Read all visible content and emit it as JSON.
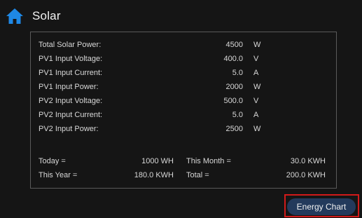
{
  "header": {
    "title": "Solar",
    "home_icon": "home-icon",
    "home_icon_color": "#1e88e5"
  },
  "readings": [
    {
      "label": "Total Solar Power:",
      "value": "4500",
      "unit": "W"
    },
    {
      "label": "PV1 Input Voltage:",
      "value": "400.0",
      "unit": "V"
    },
    {
      "label": "PV1 Input Current:",
      "value": "5.0",
      "unit": "A"
    },
    {
      "label": "PV1 Input Power:",
      "value": "2000",
      "unit": "W"
    },
    {
      "label": "PV2 Input Voltage:",
      "value": "500.0",
      "unit": "V"
    },
    {
      "label": "PV2 Input Current:",
      "value": "5.0",
      "unit": "A"
    },
    {
      "label": "PV2 Input Power:",
      "value": "2500",
      "unit": "W"
    }
  ],
  "summary": {
    "today": {
      "label": "Today =",
      "value": "1000 WH"
    },
    "this_month": {
      "label": "This Month =",
      "value": "30.0 KWH"
    },
    "this_year": {
      "label": "This Year =",
      "value": "180.0 KWH"
    },
    "total": {
      "label": "Total =",
      "value": "200.0 KWH"
    }
  },
  "footer": {
    "energy_chart_label": "Energy Chart",
    "button_color": "#233a5c",
    "highlight_color": "#d11a1a"
  }
}
